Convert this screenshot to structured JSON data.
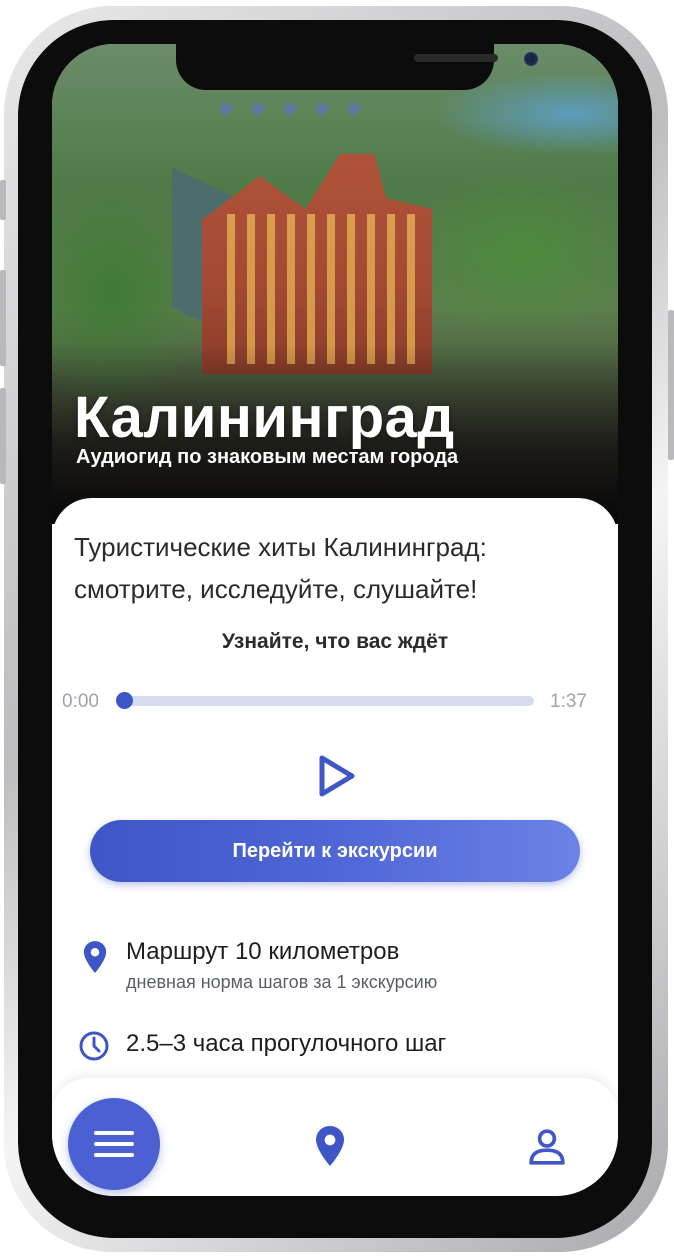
{
  "hero": {
    "title": "Калининград",
    "subtitle": "Аудиогид по знаковым местам города"
  },
  "content": {
    "intro": "Туристические хиты Калининград: смотрите, исследуйте, слушайте!",
    "promo_label": "Узнайте, что вас ждёт"
  },
  "player": {
    "current_time": "0:00",
    "duration": "1:37",
    "progress": 0.0,
    "play_icon": "play-icon"
  },
  "cta": {
    "label": "Перейти к экскурсии"
  },
  "info": {
    "route_title": "Маршрут 10 километров",
    "route_subtitle": "дневная норма шагов за 1 экскурсию",
    "duration_text": "2.5–3 часа прогулочного шаг",
    "route_icon": "map-pin-icon",
    "duration_icon": "clock-icon"
  },
  "nav": {
    "items": [
      "menu-icon",
      "map-pin-icon",
      "user-icon"
    ]
  },
  "colors": {
    "accent": "#3f56c6",
    "accent_light": "#6b82e6",
    "track": "#d6dbef",
    "text": "#2b2b2b",
    "muted": "#a0a3aa"
  }
}
